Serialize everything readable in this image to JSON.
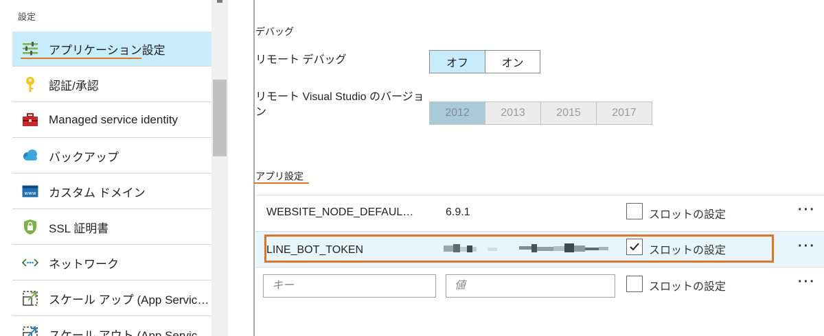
{
  "sidebar": {
    "heading": "設定",
    "items": [
      {
        "label": "アプリケーション設定",
        "icon": "app-settings-icon",
        "active": true
      },
      {
        "label": "認証/承認",
        "icon": "key-icon"
      },
      {
        "label": "Managed service identity",
        "icon": "toolbox-icon"
      },
      {
        "label": "バックアップ",
        "icon": "cloud-backup-icon"
      },
      {
        "label": "カスタム ドメイン",
        "icon": "www-domain-icon"
      },
      {
        "label": "SSL 証明書",
        "icon": "shield-lock-icon"
      },
      {
        "label": "ネットワーク",
        "icon": "network-icon"
      },
      {
        "label": "スケール アップ (App Service プラン)",
        "icon": "scale-up-icon"
      },
      {
        "label": "スケール アウト (App Service プラン)",
        "icon": "scale-out-icon"
      }
    ]
  },
  "debug": {
    "section_title": "デバッグ",
    "remote_debug_label": "リモート デバッグ",
    "remote_debug_options": [
      "オフ",
      "オン"
    ],
    "remote_debug_selected": "オフ",
    "vs_version_label": "リモート Visual Studio のバージョン",
    "vs_version_options": [
      "2012",
      "2013",
      "2015",
      "2017"
    ],
    "vs_version_selected": "2012"
  },
  "app_settings": {
    "section_title": "アプリ設定",
    "slot_label": "スロットの設定",
    "more_label": "···",
    "rows": [
      {
        "name": "WEBSITE_NODE_DEFAUL…",
        "value": "6.9.1",
        "slot_checked": false
      },
      {
        "name": "LINE_BOT_TOKEN",
        "value": "",
        "slot_checked": true
      }
    ],
    "new_row": {
      "key_placeholder": "キー",
      "value_placeholder": "値",
      "slot_checked": false
    }
  },
  "colors": {
    "accent": "#e8731d",
    "selected_bg": "#c7ecfb"
  }
}
